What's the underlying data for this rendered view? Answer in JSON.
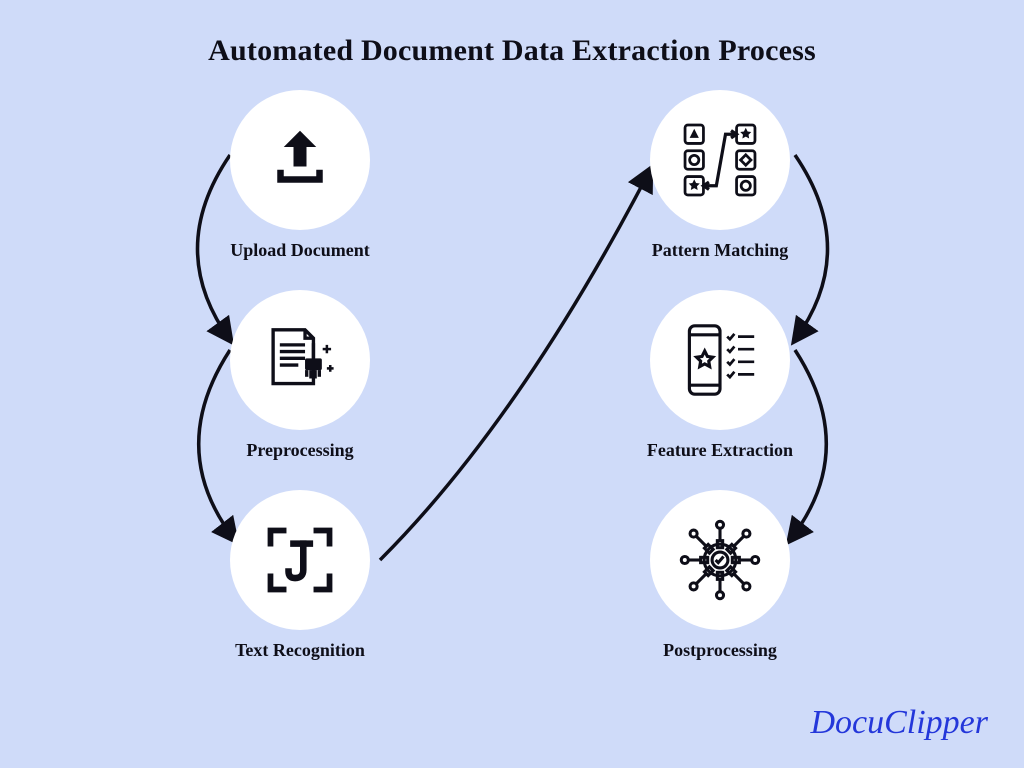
{
  "title": "Automated Document Data Extraction Process",
  "steps": [
    {
      "label": "Upload Document",
      "icon": "upload-icon"
    },
    {
      "label": "Preprocessing",
      "icon": "preprocessing-icon"
    },
    {
      "label": "Text Recognition",
      "icon": "text-recognition-icon"
    },
    {
      "label": "Pattern Matching",
      "icon": "pattern-matching-icon"
    },
    {
      "label": "Feature Extraction",
      "icon": "feature-extraction-icon"
    },
    {
      "label": "Postprocessing",
      "icon": "postprocessing-icon"
    }
  ],
  "brand": "DocuClipper",
  "colors": {
    "bg": "#cfdbf9",
    "brand": "#2437da",
    "ink": "#0e0e18"
  }
}
